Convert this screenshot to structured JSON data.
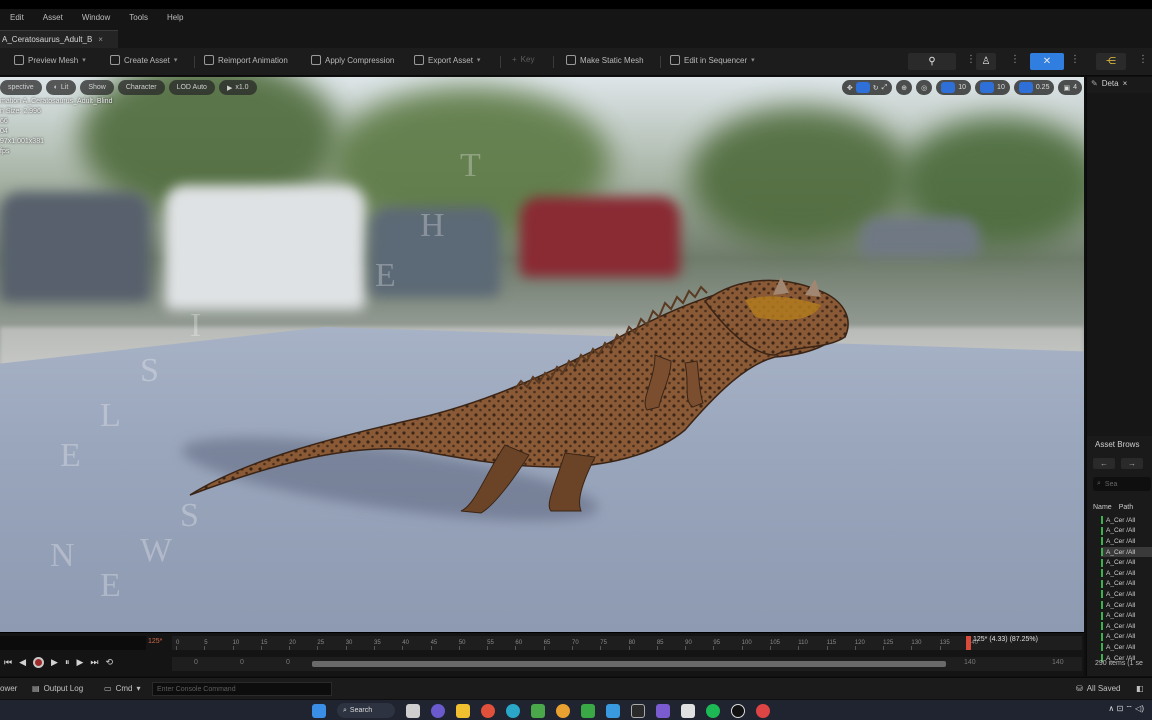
{
  "menu": [
    "Edit",
    "Asset",
    "Window",
    "Tools",
    "Help"
  ],
  "tab": {
    "title": "A_Ceratosaurus_Adult_B",
    "close": "×"
  },
  "toolbar": {
    "preview_mesh": "Preview Mesh",
    "create_asset": "Create Asset",
    "reimport": "Reimport Animation",
    "apply_compression": "Apply Compression",
    "export_asset": "Export Asset",
    "key": "Key",
    "make_static_mesh": "Make Static Mesh",
    "edit_in_sequencer": "Edit in Sequencer"
  },
  "viewport": {
    "pills": [
      "spective",
      "Lit",
      "Show",
      "Character",
      "LOD Auto",
      "x1.0"
    ],
    "hud_lines": [
      "mation A_Ceratosaurus_Adult_Blind",
      "n Size: 2.996",
      "66",
      "04",
      "97x1.001x381",
      "fps"
    ],
    "right_values": [
      "10",
      "0.25",
      "4"
    ],
    "watermark": [
      "T",
      "H",
      "E",
      "I",
      "S",
      "L",
      "E",
      "N",
      "E",
      "W",
      "S"
    ]
  },
  "details": {
    "tab": "Deta",
    "close": "×"
  },
  "asset_browser": {
    "title": "Asset Brows",
    "search_placeholder": "Sea",
    "col_name": "Name",
    "col_path": "Path",
    "rows": [
      "A_Cer /All",
      "A_Cer /All",
      "A_Cer /All",
      "A_Cer /All",
      "A_Cer /All",
      "A_Cer /All",
      "A_Cer /All",
      "A_Cer /All",
      "A_Cer /All",
      "A_Cer /All",
      "A_Cer /All",
      "A_Cer /All",
      "A_Cer /All",
      "A_Cer /All"
    ],
    "selected_index": 3,
    "count": "290 items (1 se"
  },
  "timeline": {
    "frame_badge": "125*",
    "time_label": "125* (4.33) (87.25%)",
    "ticks": [
      "0",
      "5",
      "10",
      "15",
      "20",
      "25",
      "30",
      "35",
      "40",
      "45",
      "50",
      "55",
      "60",
      "65",
      "70",
      "75",
      "80",
      "85",
      "90",
      "95",
      "100",
      "105",
      "110",
      "115",
      "120",
      "125",
      "130",
      "135",
      "140"
    ],
    "track_left": [
      "0",
      "0",
      "0"
    ],
    "track_right": [
      "140",
      "140"
    ]
  },
  "statusbar": {
    "left": "ower",
    "output_log": "Output Log",
    "cmd": "Cmd",
    "console_placeholder": "Enter Console Command",
    "all_saved": "All Saved"
  },
  "taskbar": {
    "search": "Search",
    "tray": "∧  ⊡  ⌔  ◁)"
  }
}
